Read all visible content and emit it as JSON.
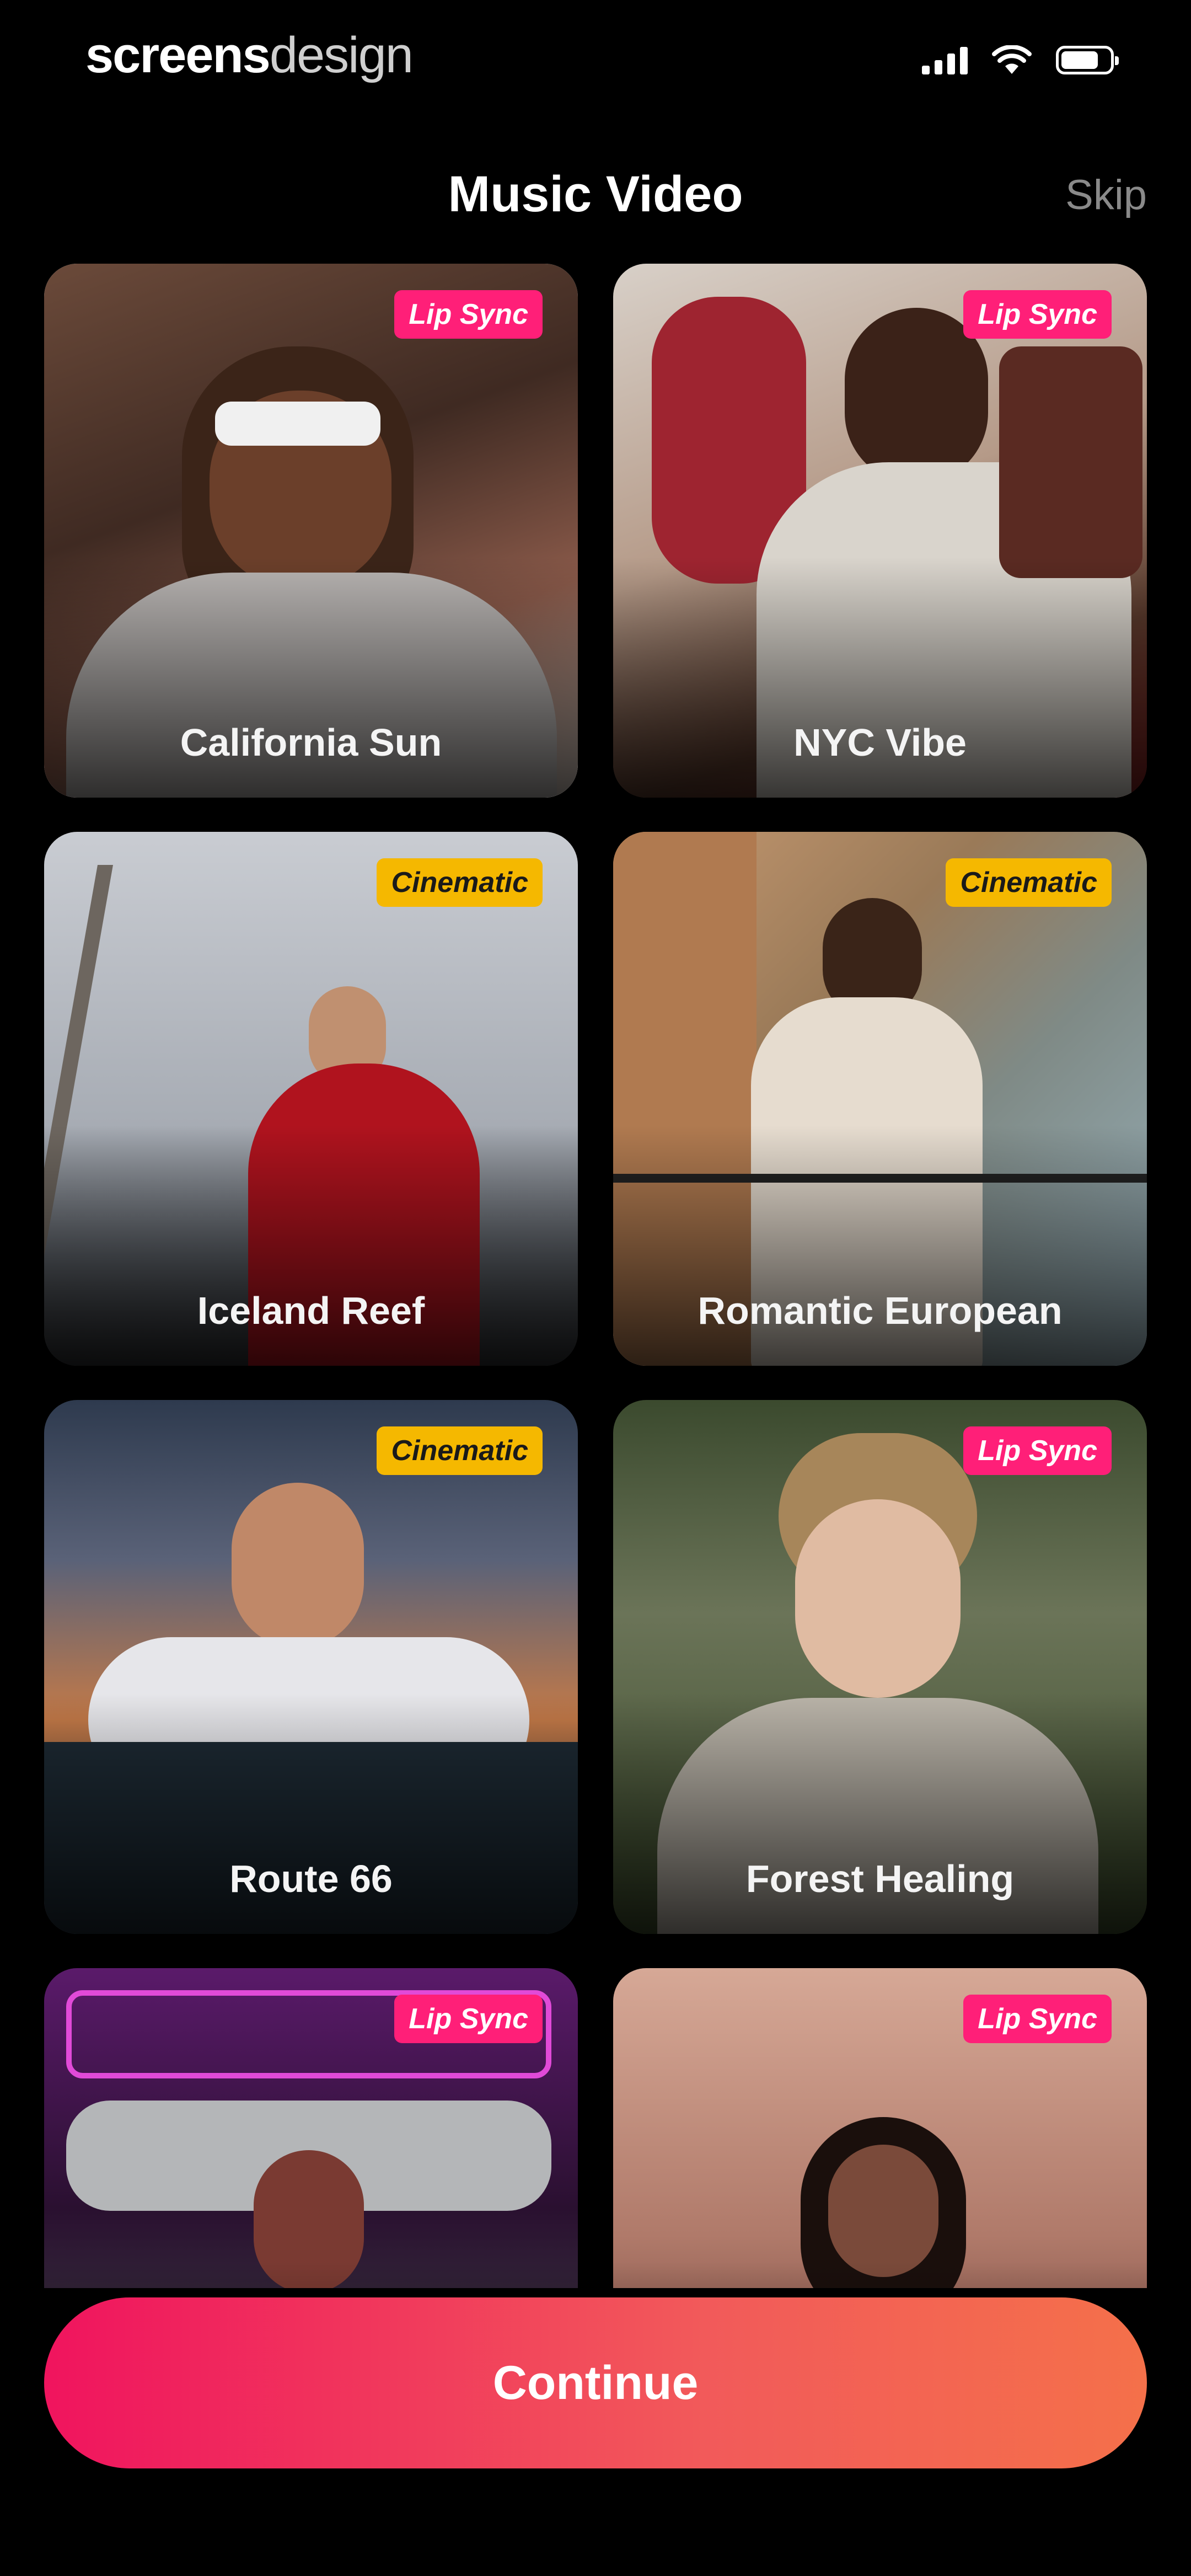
{
  "status_bar": {
    "brand_bold": "screens",
    "brand_light": "design",
    "icons": [
      "signal-icon",
      "wifi-icon",
      "battery-icon"
    ]
  },
  "header": {
    "title": "Music Video",
    "skip_label": "Skip"
  },
  "badge_colors": {
    "Lip Sync": "#ff1f78",
    "Cinematic": "#f5b800"
  },
  "cards": [
    {
      "label": "California Sun",
      "badge": "Lip Sync",
      "selected": true
    },
    {
      "label": "NYC Vibe",
      "badge": "Lip Sync",
      "selected": false
    },
    {
      "label": "Iceland Reef",
      "badge": "Cinematic",
      "selected": false
    },
    {
      "label": "Romantic European",
      "badge": "Cinematic",
      "selected": false
    },
    {
      "label": "Route 66",
      "badge": "Cinematic",
      "selected": false
    },
    {
      "label": "Forest Healing",
      "badge": "Lip Sync",
      "selected": false
    },
    {
      "label": "",
      "badge": "Lip Sync",
      "selected": false
    },
    {
      "label": "",
      "badge": "Lip Sync",
      "selected": false
    }
  ],
  "cta": {
    "label": "Continue",
    "gradient": [
      "#f0145e",
      "#f4704a"
    ]
  }
}
